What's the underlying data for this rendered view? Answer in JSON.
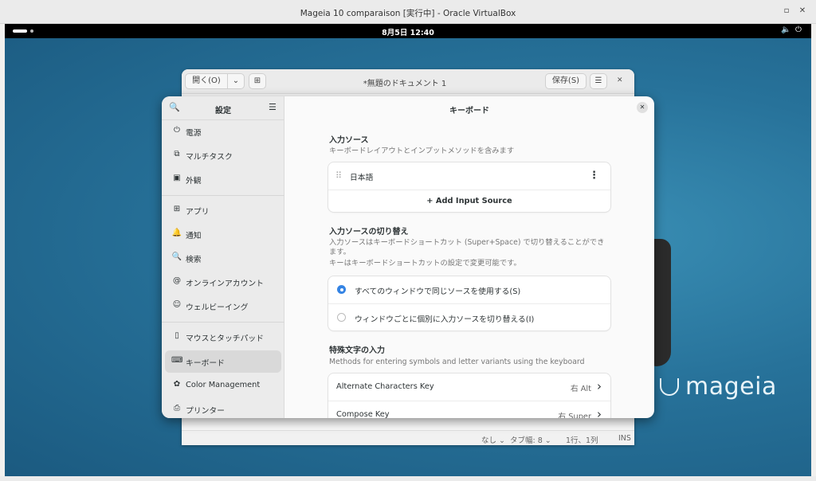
{
  "vbox": {
    "title": "Mageia 10 comparaison [実行中] - Oracle VirtualBox",
    "restore_icon": "▫",
    "close_icon": "✕"
  },
  "topbar": {
    "clock": "8月5日  12:40",
    "volume_icon": "🔈",
    "power_icon": "⏻"
  },
  "desktop": {
    "logo_text": "mageia"
  },
  "texteditor": {
    "open_label": "開く(O)",
    "chevron": "⌄",
    "new_tab_icon": "⊞",
    "title": "*無題のドキュメント 1",
    "save_label": "保存(S)",
    "menu_icon": "☰",
    "close_icon": "✕",
    "status": {
      "lang": "なし ⌄",
      "tab": "タブ幅: 8 ⌄",
      "pos": "1行、1列",
      "mode": "INS"
    }
  },
  "settings": {
    "sidebar_title": "設定",
    "search_icon": "🔍",
    "menu_icon": "☰",
    "items": [
      {
        "label": "電源",
        "icon": "⏻"
      },
      {
        "label": "マルチタスク",
        "icon": "⧉"
      },
      {
        "label": "外観",
        "icon": "▣"
      },
      {
        "label": "アプリ",
        "icon": "⊞"
      },
      {
        "label": "通知",
        "icon": "🔔"
      },
      {
        "label": "検索",
        "icon": "🔍"
      },
      {
        "label": "オンラインアカウント",
        "icon": "@"
      },
      {
        "label": "ウェルビーイング",
        "icon": "☺"
      },
      {
        "label": "マウスとタッチパッド",
        "icon": "▯"
      },
      {
        "label": "キーボード",
        "icon": "⌨"
      },
      {
        "label": "Color Management",
        "icon": "✿"
      },
      {
        "label": "プリンター",
        "icon": "⎙"
      }
    ],
    "page_title": "キーボード",
    "close_icon": "✕",
    "input_sources": {
      "title": "入力ソース",
      "desc": "キーボードレイアウトとインプットメソッドを含みます",
      "source": "日本語",
      "drag_icon": "⠿",
      "more_icon": "⋮",
      "add_label": "+ Add Input Source"
    },
    "switching": {
      "title": "入力ソースの切り替え",
      "desc1": "入力ソースはキーボードショートカット (Super+Space) で切り替えることができます。",
      "desc2": "キーはキーボードショートカットの設定で変更可能です。",
      "option1": "すべてのウィンドウで同じソースを使用する(S)",
      "option2": "ウィンドウごとに個別に入力ソースを切り替える(I)"
    },
    "special": {
      "title": "特殊文字の入力",
      "desc": "Methods for entering symbols and letter variants using the keyboard",
      "rows": [
        {
          "label": "Alternate Characters Key",
          "value": "右 Alt"
        },
        {
          "label": "Compose Key",
          "value": "右 Super"
        }
      ],
      "arrow": "›"
    }
  }
}
